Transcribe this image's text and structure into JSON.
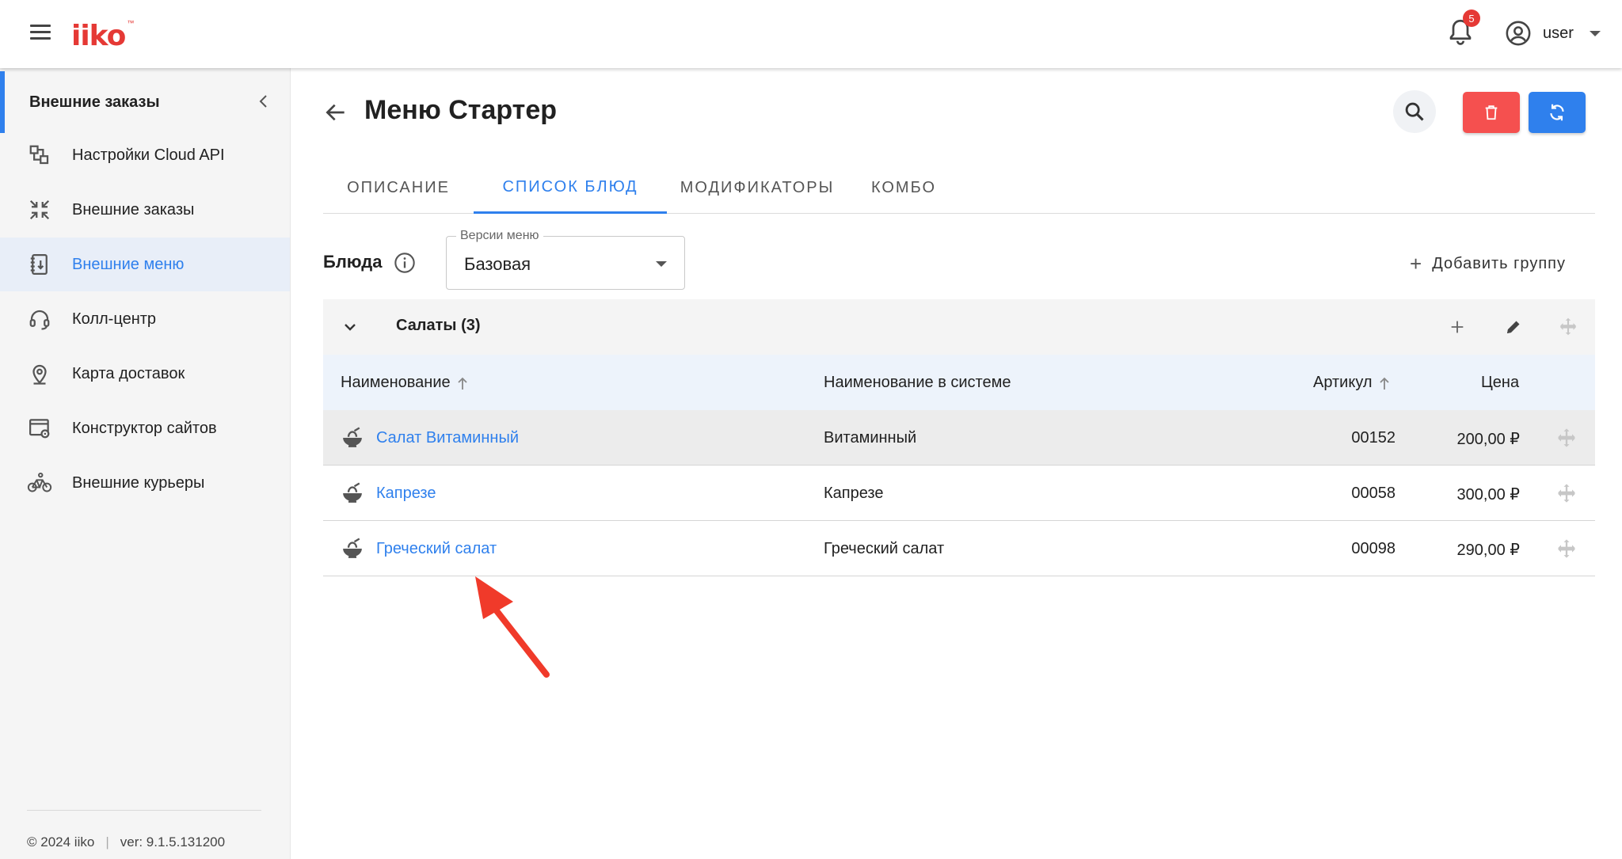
{
  "topbar": {
    "logo": "iiko",
    "logo_tm": "™",
    "notifications_count": "5",
    "user_name": "user"
  },
  "sidebar": {
    "header_title": "Внешние заказы",
    "items": [
      {
        "label": "Настройки Cloud API",
        "icon": "cloud-api-settings-icon",
        "active": false
      },
      {
        "label": "Внешние заказы",
        "icon": "external-orders-icon",
        "active": false
      },
      {
        "label": "Внешние меню",
        "icon": "external-menu-icon",
        "active": true
      },
      {
        "label": "Колл-центр",
        "icon": "headset-icon",
        "active": false
      },
      {
        "label": "Карта доставок",
        "icon": "map-pin-icon",
        "active": false
      },
      {
        "label": "Конструктор сайтов",
        "icon": "site-builder-icon",
        "active": false
      },
      {
        "label": "Внешние курьеры",
        "icon": "bicycle-icon",
        "active": false
      }
    ],
    "footer_copyright": "© 2024 iiko",
    "footer_version": "ver: 9.1.5.131200"
  },
  "page": {
    "title": "Меню Стартер"
  },
  "tabs": [
    {
      "label": "ОПИСАНИЕ",
      "active": false
    },
    {
      "label": "СПИСОК БЛЮД",
      "active": true
    },
    {
      "label": "МОДИФИКАТОРЫ",
      "active": false
    },
    {
      "label": "КОМБО",
      "active": false
    }
  ],
  "dishes": {
    "label": "Блюда",
    "version_label": "Версии меню",
    "version_value": "Базовая",
    "add_group": "Добавить группу"
  },
  "group": {
    "title": "Салаты (3)"
  },
  "table": {
    "headers": {
      "name": "Наименование",
      "system_name": "Наименование в системе",
      "article": "Артикул",
      "price": "Цена"
    },
    "rows": [
      {
        "name": "Салат Витаминный",
        "system_name": "Витаминный",
        "article": "00152",
        "price": "200,00 ₽"
      },
      {
        "name": "Капрезе",
        "system_name": "Капрезе",
        "article": "00058",
        "price": "300,00 ₽"
      },
      {
        "name": "Греческий салат",
        "system_name": "Греческий салат",
        "article": "00098",
        "price": "290,00 ₽"
      }
    ]
  },
  "colors": {
    "accent": "#2f80ed",
    "danger": "#f5504f",
    "brand": "#e53935",
    "annotation": "#f03a2a"
  }
}
